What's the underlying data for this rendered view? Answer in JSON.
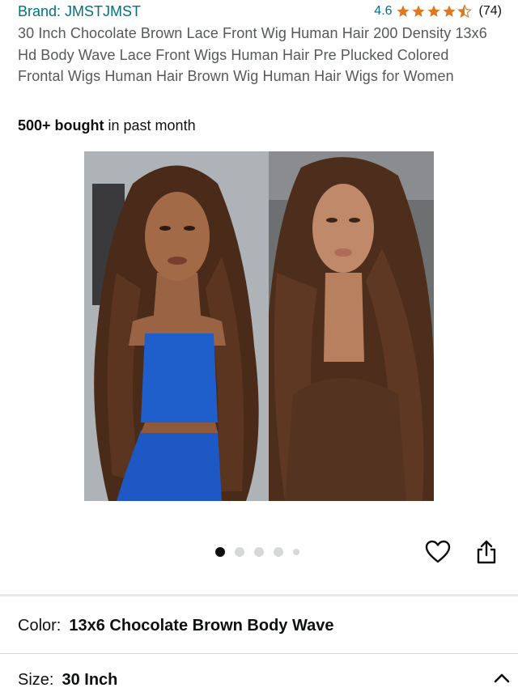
{
  "product": {
    "brand": "Brand: JMSTJMST",
    "rating": "4.6",
    "stars_filled": 4.5,
    "review_count": "(74)",
    "title": "30 Inch Chocolate Brown Lace Front Wig Human Hair 200 Density 13x6 Hd Body Wave Lace Front Wigs Human Hair Pre Plucked Colored Frontal Wigs Human Hair Brown Wig Human Hair Wigs for Women",
    "bought_bold": "500+ bought",
    "bought_rest": " in past month"
  },
  "gallery": {
    "image_count": 5,
    "active_index": 0
  },
  "variants": {
    "color_label": "Color:",
    "color_value": "13x6 Chocolate Brown Body Wave",
    "size_label": "Size:",
    "size_value": "30 Inch"
  },
  "colors": {
    "link": "#007185",
    "star": "#de7921",
    "text": "#0f1111",
    "muted": "#565959"
  }
}
